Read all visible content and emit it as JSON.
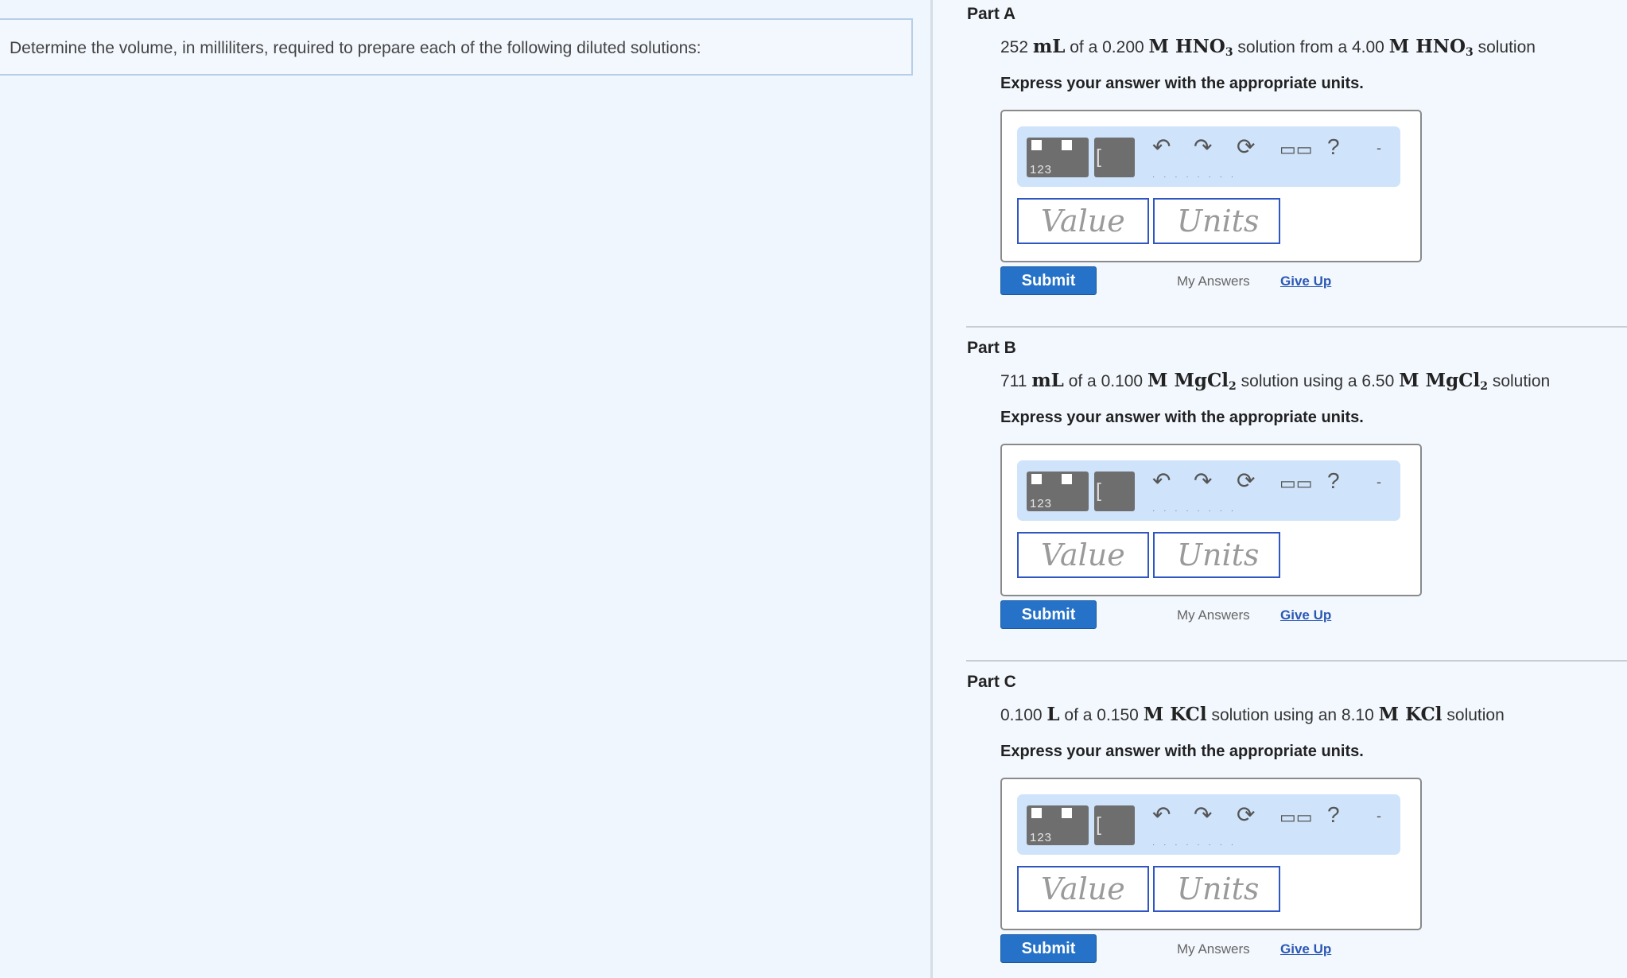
{
  "intro": {
    "text": "Determine the volume, in milliliters, required to prepare each of the following diluted solutions:"
  },
  "answer_template": {
    "instruction": "Express your answer with the appropriate units.",
    "units_template_label": "123",
    "value_placeholder": "Value",
    "units_placeholder": "Units",
    "submit_label": "Submit",
    "my_answers_label": "My Answers",
    "give_up_label": "Give Up"
  },
  "parts": [
    {
      "title": "Part A",
      "question": {
        "volume_value": "252",
        "volume_unit": "mL",
        "text_1": "of a",
        "target_conc": "0.200",
        "conc_unit": "M",
        "solute": "HNO",
        "solute_sub": "3",
        "text_2": "solution from a",
        "stock_conc": "4.00",
        "text_3": "solution"
      },
      "instruction": "Express your answer with the appropriate units.",
      "value_placeholder": "Value",
      "units_placeholder": "Units",
      "submit_label": "Submit",
      "my_answers_label": "My Answers",
      "give_up_label": "Give Up"
    },
    {
      "title": "Part B",
      "question": {
        "volume_value": "711",
        "volume_unit": "mL",
        "text_1": "of a",
        "target_conc": "0.100",
        "conc_unit": "M",
        "solute": "MgCl",
        "solute_sub": "2",
        "text_2": "solution using a",
        "stock_conc": "6.50",
        "text_3": "solution"
      },
      "instruction": "Express your answer with the appropriate units.",
      "value_placeholder": "Value",
      "units_placeholder": "Units",
      "submit_label": "Submit",
      "my_answers_label": "My Answers",
      "give_up_label": "Give Up"
    },
    {
      "title": "Part C",
      "question": {
        "volume_value": "0.100",
        "volume_unit": "L",
        "text_1": "of a",
        "target_conc": "0.150",
        "conc_unit": "M",
        "solute": "KCl",
        "solute_sub": "",
        "text_2": "solution using an",
        "stock_conc": "8.10",
        "text_3": "solution"
      },
      "instruction": "Express your answer with the appropriate units.",
      "value_placeholder": "Value",
      "units_placeholder": "Units",
      "submit_label": "Submit",
      "my_answers_label": "My Answers",
      "give_up_label": "Give Up"
    }
  ],
  "toolbar_icons": [
    "units-template-icon",
    "value-template-icon",
    "undo-icon",
    "redo-icon",
    "reset-icon",
    "keyboard-icon",
    "help-icon",
    "more-icon"
  ]
}
